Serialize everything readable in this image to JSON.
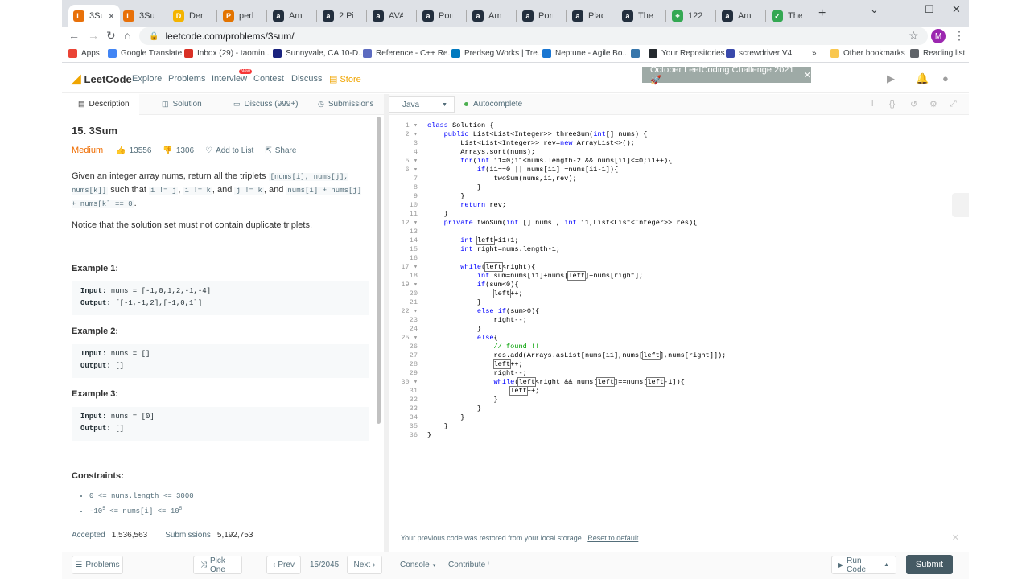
{
  "browser": {
    "tabs": [
      {
        "label": "3Su",
        "color": "#e8710a",
        "glyph": "L",
        "close": "✕"
      },
      {
        "label": "3Su",
        "color": "#e8710a",
        "glyph": "L"
      },
      {
        "label": "Der",
        "color": "#f4b400",
        "glyph": "D"
      },
      {
        "label": "perl",
        "color": "#e37400",
        "glyph": "P"
      },
      {
        "label": "Am",
        "color": "#232f3e",
        "glyph": "a"
      },
      {
        "label": "2 Pi",
        "color": "#232f3e",
        "glyph": "a"
      },
      {
        "label": "AVA",
        "color": "#232f3e",
        "glyph": "a"
      },
      {
        "label": "Port",
        "color": "#232f3e",
        "glyph": "a"
      },
      {
        "label": "Am",
        "color": "#232f3e",
        "glyph": "a"
      },
      {
        "label": "Port",
        "color": "#232f3e",
        "glyph": "a"
      },
      {
        "label": "Plac",
        "color": "#232f3e",
        "glyph": "a"
      },
      {
        "label": "The",
        "color": "#232f3e",
        "glyph": "a"
      },
      {
        "label": "122",
        "color": "#34a853",
        "glyph": "⌖"
      },
      {
        "label": "Am",
        "color": "#232f3e",
        "glyph": "a"
      },
      {
        "label": "The",
        "color": "#34a853",
        "glyph": "✓"
      }
    ],
    "new_tab": "+",
    "window_controls": {
      "minimize": "⌄",
      "min": "—",
      "max": "☐",
      "close": "✕"
    },
    "nav": {
      "back": "←",
      "forward": "→",
      "reload": "↻",
      "home": "⌂",
      "star": "☆",
      "menu": "⋮"
    },
    "url": "leetcode.com/problems/3sum/",
    "lock": "🔒",
    "profile_initial": "M",
    "bookmarks": [
      {
        "label": "Apps",
        "color": "#ea4335"
      },
      {
        "label": "Google Translate",
        "color": "#4285f4"
      },
      {
        "label": "Inbox (29) - taomin...",
        "color": "#d93025"
      },
      {
        "label": "Sunnyvale, CA 10-D...",
        "color": "#1a237e"
      },
      {
        "label": "Reference - C++ Re...",
        "color": "#5c6bc0"
      },
      {
        "label": "Predseg Works | Tre...",
        "color": "#0079bf"
      },
      {
        "label": "Neptune - Agile Bo...",
        "color": "#1976d2"
      },
      {
        "label": "",
        "color": "#3776ab"
      },
      {
        "label": "Your Repositories",
        "color": "#24292e"
      },
      {
        "label": "screwdriver V4",
        "color": "#3949ab"
      }
    ],
    "bookmarks_more": "»",
    "other_bookmarks": "Other bookmarks",
    "reading_list": "Reading list"
  },
  "lc_nav": {
    "logo": "LeetCode",
    "links": [
      "Explore",
      "Problems",
      "Interview",
      "Contest",
      "Discuss",
      "Store"
    ],
    "new_badge": "New",
    "banner": "October LeetCoding Challenge 2021 🚀",
    "banner_close": "✕"
  },
  "desc_tabs": {
    "description": "Description",
    "solution": "Solution",
    "discuss": "Discuss (999+)",
    "submissions": "Submissions"
  },
  "problem": {
    "title": "15. 3Sum",
    "difficulty": "Medium",
    "likes": "13556",
    "dislikes": "1306",
    "add_to_list": "Add to List",
    "share": "Share",
    "p1_a": "Given an integer array nums, return all the triplets ",
    "p1_c1": "[nums[i], nums[j], nums[k]]",
    "p1_b": " such that ",
    "p1_c2": "i != j",
    "p1_s1": ", ",
    "p1_c3": "i != k",
    "p1_s2": ", and ",
    "p1_c4": "j != k",
    "p1_s3": ", and ",
    "p1_c5": "nums[i] + nums[j] + nums[k] == 0",
    "p1_end": ".",
    "p2": "Notice that the solution set must not contain duplicate triplets.",
    "examples": [
      {
        "title": "Example 1:",
        "input_label": "Input:",
        "input": " nums = [-1,0,1,2,-1,-4]",
        "output_label": "Output:",
        "output": " [[-1,-1,2],[-1,0,1]]"
      },
      {
        "title": "Example 2:",
        "input_label": "Input:",
        "input": " nums = []",
        "output_label": "Output:",
        "output": " []"
      },
      {
        "title": "Example 3:",
        "input_label": "Input:",
        "input": " nums = [0]",
        "output_label": "Output:",
        "output": " []"
      }
    ],
    "constraints_title": "Constraints:",
    "constraint1": "0 <= nums.length <= 3000",
    "constraint2_a": "-10",
    "constraint2_b": "5",
    "constraint2_c": " <= nums[i] <= 10",
    "constraint2_d": "5",
    "accepted_label": "Accepted",
    "accepted": "1,536,563",
    "submissions_label": "Submissions",
    "submissions": "5,192,753"
  },
  "editor": {
    "language": "Java",
    "autocomplete": "Autocomplete",
    "icons": [
      "i",
      "{}",
      "↺",
      "⚙",
      "⤢"
    ],
    "code_lines": [
      "class Solution {",
      "    public List<List<Integer>> threeSum(int[] nums) {",
      "        List<List<Integer>> rev=new ArrayList<>();",
      "        Arrays.sort(nums);",
      "        for(int i1=0;i1<nums.length-2 && nums[i1]<=0;i1++){",
      "            if(i1==0 || nums[i1]!=nums[i1-1]){",
      "                twoSum(nums,i1,rev);",
      "            }",
      "        }",
      "        return rev;",
      "    }",
      "    private twoSum(int [] nums , int i1,List<List<Integer>> res){",
      "",
      "        int left=i1+1;",
      "        int right=nums.length-1;",
      "",
      "        while(left<right){",
      "            int sum=nums[i1]+nums[left]+nums[right];",
      "            if(sum<0){",
      "                left++;",
      "            }",
      "            else if(sum>0){",
      "                right--;",
      "            }",
      "            else{",
      "                // found !!",
      "                res.add(Arrays.asList[nums[i1],nums[left],nums[right]]);",
      "                left++;",
      "                right--;",
      "                while(left<right && nums[left]==nums[left-1]){",
      "                    left++;",
      "                }",
      "            }",
      "        }",
      "    }",
      "}"
    ],
    "restore_msg": "Your previous code was restored from your local storage.",
    "reset_link": "Reset to default",
    "restore_close": "✕"
  },
  "bottom": {
    "problems": "Problems",
    "pick_one": "Pick One",
    "prev": "Prev",
    "page": "15/2045",
    "next": "Next",
    "console": "Console",
    "contribute": "Contribute",
    "run_code": "Run Code",
    "submit": "Submit"
  }
}
